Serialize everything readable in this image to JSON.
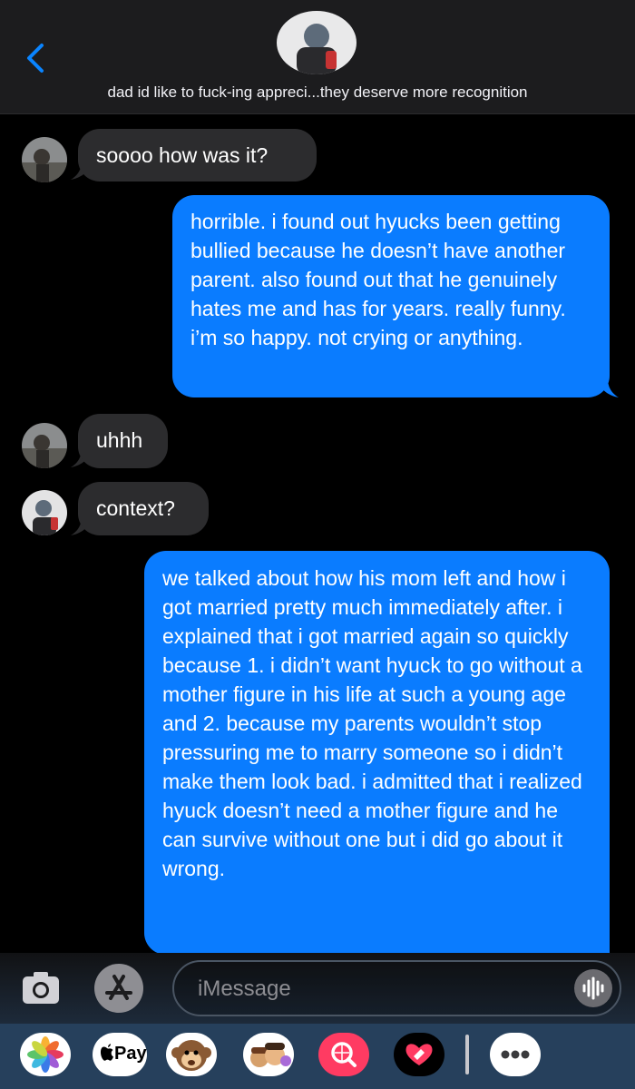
{
  "header": {
    "title": "dad id like to fuck-ing appreci...they deserve more recognition"
  },
  "messages": [
    {
      "type": "received",
      "text": "soooo how was it?"
    },
    {
      "type": "sent",
      "text": "horrible. i found out hyucks been getting bullied because he doesn’t have another parent. also found out that he genuinely hates me and has for years. really funny. i’m so happy. not crying or anything."
    },
    {
      "type": "received",
      "text": "uhhh"
    },
    {
      "type": "received",
      "text": "context?"
    },
    {
      "type": "sent",
      "text": "we talked about how his mom left and how i got married pretty much immediately after. i explained that i got married again so quickly because 1. i didn’t want hyuck to go without a mother figure in his life at such a young age and 2. because my parents wouldn’t stop pressuring me to marry someone so i didn’t make them look bad. i admitted that i realized hyuck doesn’t need a mother figure and he can survive without one but i did go about it wrong."
    }
  ],
  "compose": {
    "placeholder": "iMessage"
  },
  "drawer": {
    "apple_pay_label": "Pay"
  },
  "colors": {
    "sent_bubble": "#0a7cff",
    "received_bubble": "#2c2c2e",
    "accent": "#0a84ff"
  }
}
